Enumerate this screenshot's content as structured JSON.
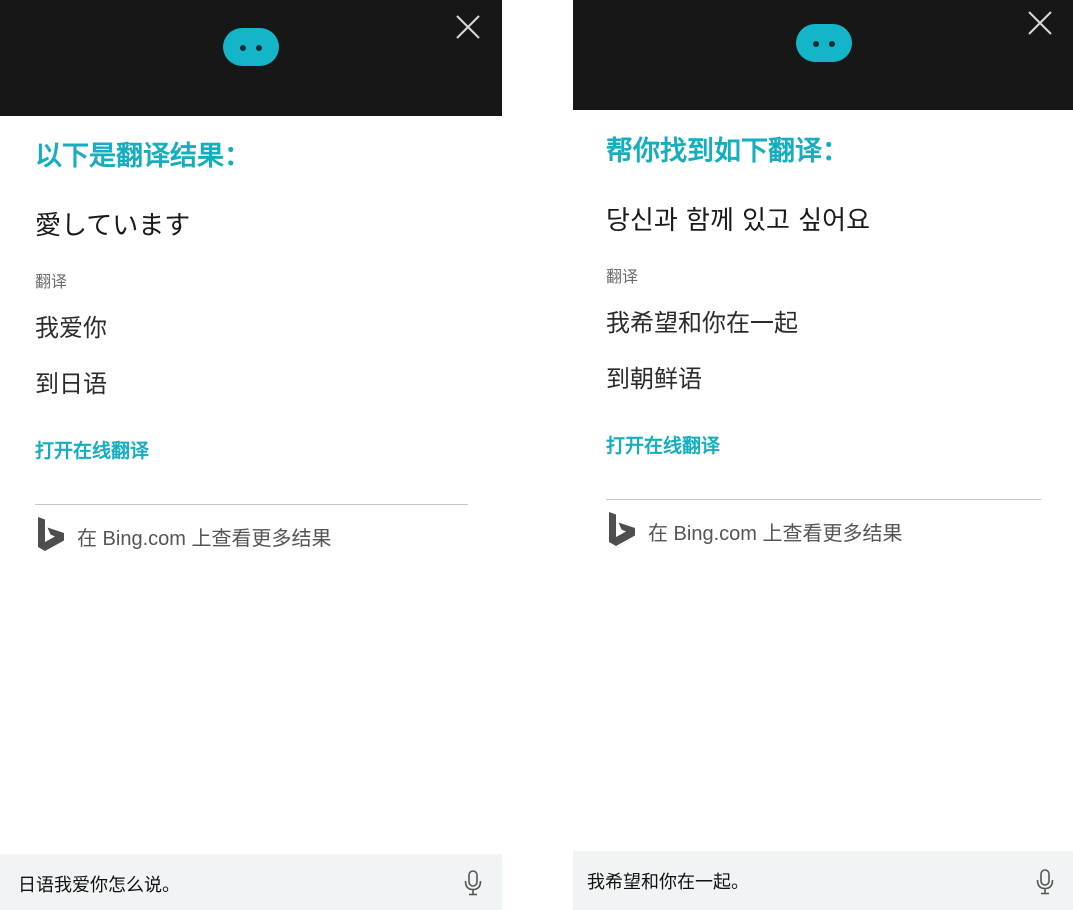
{
  "panels": [
    {
      "heading": "以下是翻译结果：",
      "result": "愛しています",
      "label": "翻译",
      "source_text": "我爱你",
      "target_language": "到日语",
      "open_link": "打开在线翻译",
      "bing_text": "在 Bing.com 上查看更多结果",
      "input_text": "日语我爱你怎么说。"
    },
    {
      "heading": "帮你找到如下翻译：",
      "result": "당신과 함께 있고 싶어요",
      "label": "翻译",
      "source_text": "我希望和你在一起",
      "target_language": "到朝鲜语",
      "open_link": "打开在线翻译",
      "bing_text": "在 Bing.com 上查看更多结果",
      "input_text": "我希望和你在一起。"
    }
  ],
  "colors": {
    "header_bg": "#171717",
    "accent": "#14aebf",
    "cortana": "#12b6c8",
    "input_bg": "#f1f4f5"
  },
  "icons": {
    "cortana": "cortana-face-icon",
    "close": "close-icon",
    "bing": "bing-logo-icon",
    "mic": "microphone-icon"
  }
}
